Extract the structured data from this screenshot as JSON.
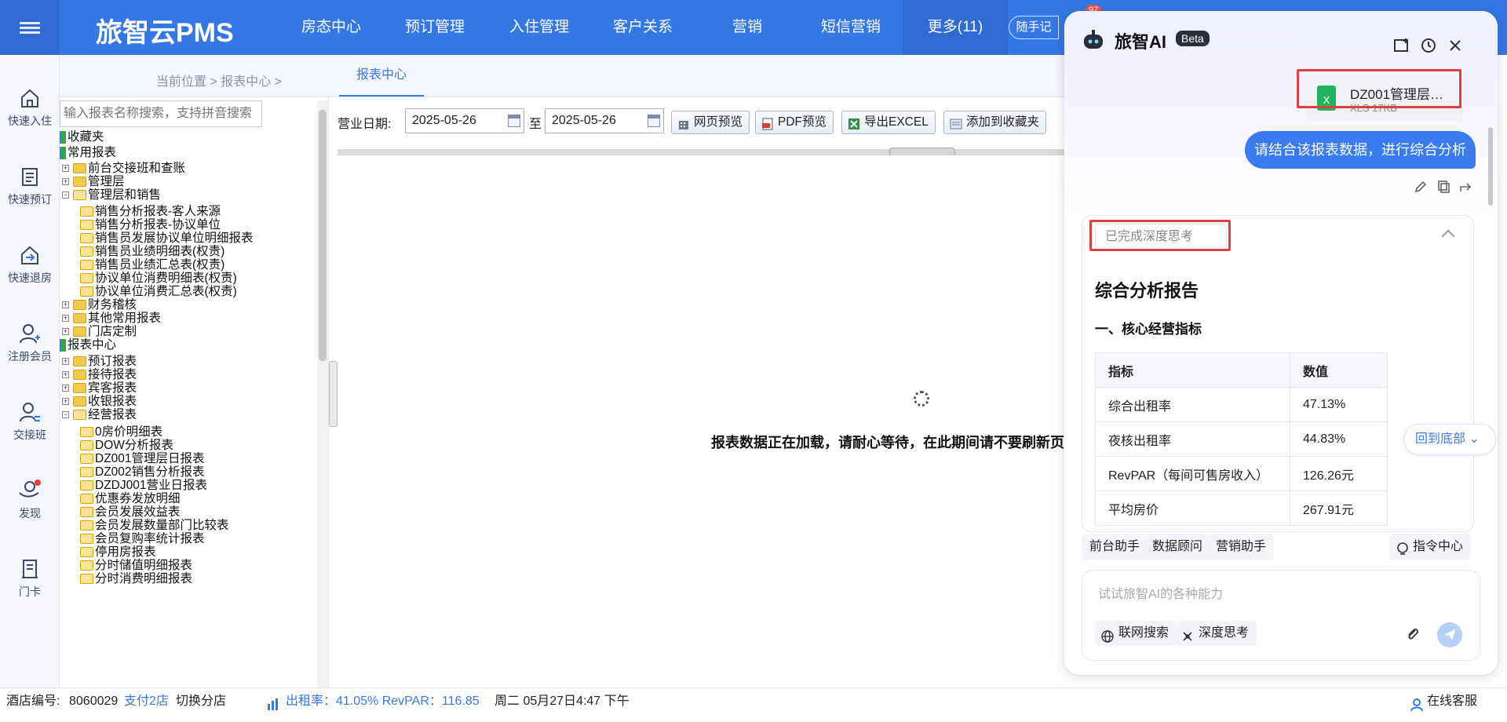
{
  "app": {
    "title": "旅智云PMS",
    "colors": {
      "primary": "#3478e5",
      "ai_accent": "#3a7bf0",
      "highlight": "#e0403d"
    }
  },
  "nav": [
    {
      "label": "房态中心"
    },
    {
      "label": "预订管理"
    },
    {
      "label": "入住管理"
    },
    {
      "label": "客户关系"
    },
    {
      "label": "营销"
    },
    {
      "label": "短信营销"
    },
    {
      "label": "更多(11)",
      "active": true
    }
  ],
  "notes_button": "随手记",
  "notes_badge": "97",
  "leftbar": [
    {
      "label": "快速入住",
      "icon": "home-icon"
    },
    {
      "label": "快速预订",
      "icon": "booking-icon"
    },
    {
      "label": "快速退房",
      "icon": "checkout-icon"
    },
    {
      "label": "注册会员",
      "icon": "add-member-icon"
    },
    {
      "label": "交接班",
      "icon": "shift-icon"
    },
    {
      "label": "发现",
      "icon": "discover-icon"
    },
    {
      "label": "门卡",
      "icon": "card-icon"
    }
  ],
  "breadcrumb": {
    "text": "当前位置 > 报表中心 >",
    "active_tab": "报表中心"
  },
  "tree_search_placeholder": "输入报表名称搜索，支持拼音搜索",
  "tree": [
    {
      "label": "收藏夹",
      "type": "root"
    },
    {
      "label": "常用报表",
      "type": "root"
    },
    {
      "label": "前台交接班和查账",
      "type": "folder",
      "level": 1,
      "expanded": false
    },
    {
      "label": "管理层",
      "type": "folder",
      "level": 1,
      "expanded": false
    },
    {
      "label": "管理层和销售",
      "type": "folder",
      "level": 1,
      "expanded": true
    },
    {
      "label": "销售分析报表-客人来源",
      "type": "leaf",
      "level": 2
    },
    {
      "label": "销售分析报表-协议单位",
      "type": "leaf",
      "level": 2
    },
    {
      "label": "销售员发展协议单位明细报表",
      "type": "leaf",
      "level": 2
    },
    {
      "label": "销售员业绩明细表(权责)",
      "type": "leaf",
      "level": 2
    },
    {
      "label": "销售员业绩汇总表(权责)",
      "type": "leaf",
      "level": 2
    },
    {
      "label": "协议单位消费明细表(权责)",
      "type": "leaf",
      "level": 2
    },
    {
      "label": "协议单位消费汇总表(权责)",
      "type": "leaf",
      "level": 2
    },
    {
      "label": "财务稽核",
      "type": "folder",
      "level": 1,
      "expanded": false
    },
    {
      "label": "其他常用报表",
      "type": "folder",
      "level": 1,
      "expanded": false
    },
    {
      "label": "门店定制",
      "type": "folder",
      "level": 1,
      "expanded": false
    },
    {
      "label": "报表中心",
      "type": "root"
    },
    {
      "label": "预订报表",
      "type": "folder",
      "level": 1,
      "expanded": false
    },
    {
      "label": "接待报表",
      "type": "folder",
      "level": 1,
      "expanded": false
    },
    {
      "label": "宾客报表",
      "type": "folder",
      "level": 1,
      "expanded": false
    },
    {
      "label": "收银报表",
      "type": "folder",
      "level": 1,
      "expanded": false
    },
    {
      "label": "经营报表",
      "type": "folder",
      "level": 1,
      "expanded": true
    },
    {
      "label": "0房价明细表",
      "type": "leaf",
      "level": 2
    },
    {
      "label": "DOW分析报表",
      "type": "leaf",
      "level": 2
    },
    {
      "label": "DZ001管理层日报表",
      "type": "leaf",
      "level": 2
    },
    {
      "label": "DZ002销售分析报表",
      "type": "leaf",
      "level": 2
    },
    {
      "label": "DZDJ001营业日报表",
      "type": "leaf",
      "level": 2
    },
    {
      "label": "优惠券发放明细",
      "type": "leaf",
      "level": 2
    },
    {
      "label": "会员发展效益表",
      "type": "leaf",
      "level": 2
    },
    {
      "label": "会员发展数量部门比较表",
      "type": "leaf",
      "level": 2
    },
    {
      "label": "会员复购率统计报表",
      "type": "leaf",
      "level": 2
    },
    {
      "label": "停用房报表",
      "type": "leaf",
      "level": 2
    },
    {
      "label": "分时储值明细报表",
      "type": "leaf",
      "level": 2
    },
    {
      "label": "分时消费明细报表",
      "type": "leaf",
      "level": 2
    }
  ],
  "toolbar": {
    "date_label": "营业日期:",
    "date_from": "2025-05-26",
    "to_label": "至",
    "date_to": "2025-05-26",
    "buttons": [
      "网页预览",
      "PDF预览",
      "导出EXCEL",
      "添加到收藏夹"
    ]
  },
  "loading_text": "报表数据正在加载，请耐心等待，在此期间请不要刷新页面",
  "status": {
    "hotel_label": "酒店编号:",
    "hotel_no": "8060029",
    "pay_link": "支付2店",
    "switch_btn": "切换分店",
    "metrics": "出租率：41.05% RevPAR：116.85",
    "datetime": "周二 05月27日4:47 下午",
    "service": "在线客服"
  },
  "ai": {
    "title": "旅智AI",
    "beta": "Beta",
    "file": {
      "name": "DZ001管理层…",
      "meta": "XLS 17KB"
    },
    "user_message": "请结合该报表数据，进行综合分析",
    "thinking_label": "已完成深度思考",
    "report_title": "综合分析报告",
    "section_title": "一、核心经营指标",
    "table": {
      "headers": [
        "指标",
        "数值"
      ],
      "rows": [
        [
          "综合出租率",
          "47.13%"
        ],
        [
          "夜核出租率",
          "44.83%"
        ],
        [
          "RevPAR（每间可售房收入）",
          "126.26元"
        ],
        [
          "平均房价",
          "267.91元"
        ]
      ]
    },
    "back_to_bottom": "回到底部",
    "chips": [
      "前台助手",
      "数据顾问",
      "营销助手"
    ],
    "command_center": "指令中心",
    "input_placeholder": "试试旅智AI的各种能力",
    "web_search": "联网搜索",
    "deep_think": "深度思考"
  }
}
